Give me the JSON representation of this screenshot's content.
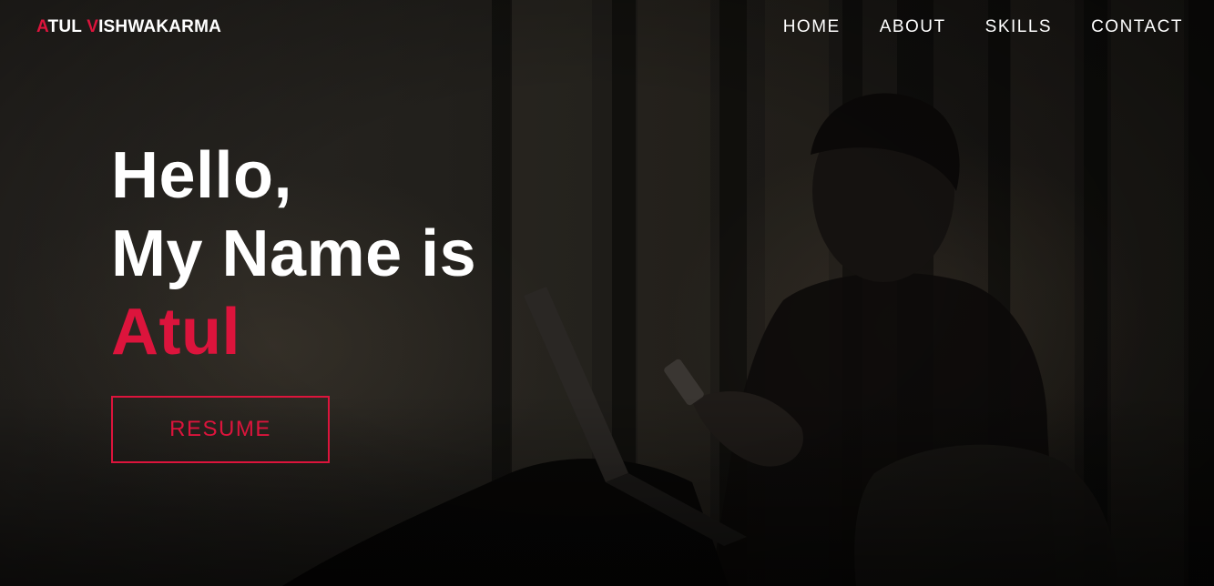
{
  "navbar": {
    "brand_first_initial": "A",
    "brand_first_rest": "TUL ",
    "brand_last_initial": "V",
    "brand_last_rest": "ISHWAKARMA",
    "links": [
      {
        "label": "HOME"
      },
      {
        "label": "ABOUT"
      },
      {
        "label": "SKILLS"
      },
      {
        "label": "CONTACT"
      }
    ]
  },
  "hero": {
    "line1": "Hello,",
    "line2": "My Name is",
    "name": "Atul",
    "button_label": "RESUME"
  },
  "colors": {
    "accent": "#dc143c",
    "text": "#ffffff",
    "background": "#161412"
  }
}
